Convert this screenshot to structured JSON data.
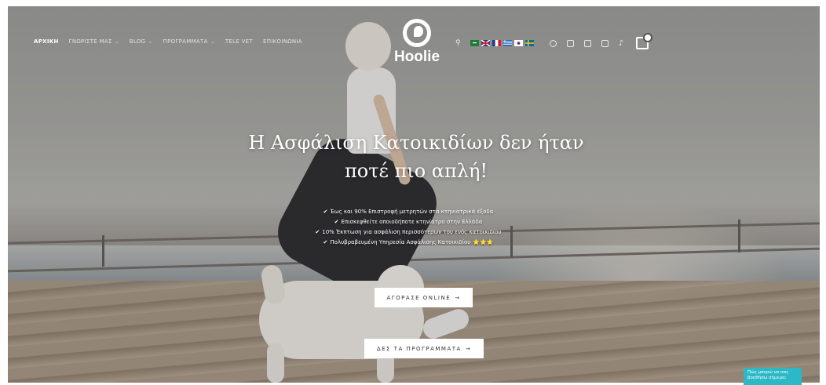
{
  "nav": {
    "items": [
      {
        "label": "ΑΡΧΙΚΗ",
        "active": true,
        "dropdown": false
      },
      {
        "label": "ΓΝΩΡΙΣΤΕ ΜΑΣ",
        "active": false,
        "dropdown": true
      },
      {
        "label": "BLOG",
        "active": false,
        "dropdown": true
      },
      {
        "label": "ΠΡΟΓΡΑΜΜΑΤΑ",
        "active": false,
        "dropdown": true
      },
      {
        "label": "TELE VET",
        "active": false,
        "dropdown": false
      },
      {
        "label": "ΕΠΙΚΟΙΝΩΝΙΑ",
        "active": false,
        "dropdown": false
      }
    ]
  },
  "brand": {
    "name": "Hoolie"
  },
  "icons": {
    "search": "search-icon",
    "flags": [
      "flag-saudi-icon",
      "flag-uk-icon",
      "flag-france-icon",
      "flag-greece-icon",
      "flag-korea-icon",
      "flag-sweden-icon"
    ],
    "socials": [
      "facebook-icon",
      "instagram-icon",
      "linkedin-icon",
      "youtube-icon",
      "tiktok-icon"
    ],
    "cart": "cart-icon"
  },
  "hero": {
    "title_line1": "Η Ασφάλιση Κατοικιδίων δεν ήταν",
    "title_line2": "ποτέ πιο απλή!",
    "bullets": [
      "Έως και 90% Επιστροφή μετρητών στα κτηνιατρικά έξοδα",
      "Επισκεφθείτε οποιοδήποτε κτηνίατρο στην Ελλάδα",
      "10% Έκπτωση για ασφάλιση περισσότερων του ενός κατοικιδίου",
      "Πολυβραβευμένη Υπηρεσία Ασφάλισης Κατοικιδίου"
    ],
    "stars": "⭐⭐⭐",
    "cta_buy": "ΑΓΟΡΑΣΕ ONLINE",
    "cta_programs": "ΔΕΣ ΤΑ ΠΡΟΓΡΑΜΜΑΤΑ",
    "arrow": "→"
  },
  "chat": {
    "text": "Πώς μπορώ να σας βοηθήσω σήμερα;"
  },
  "colors": {
    "chat": "#2db8c5",
    "stars": "#f1c232"
  }
}
